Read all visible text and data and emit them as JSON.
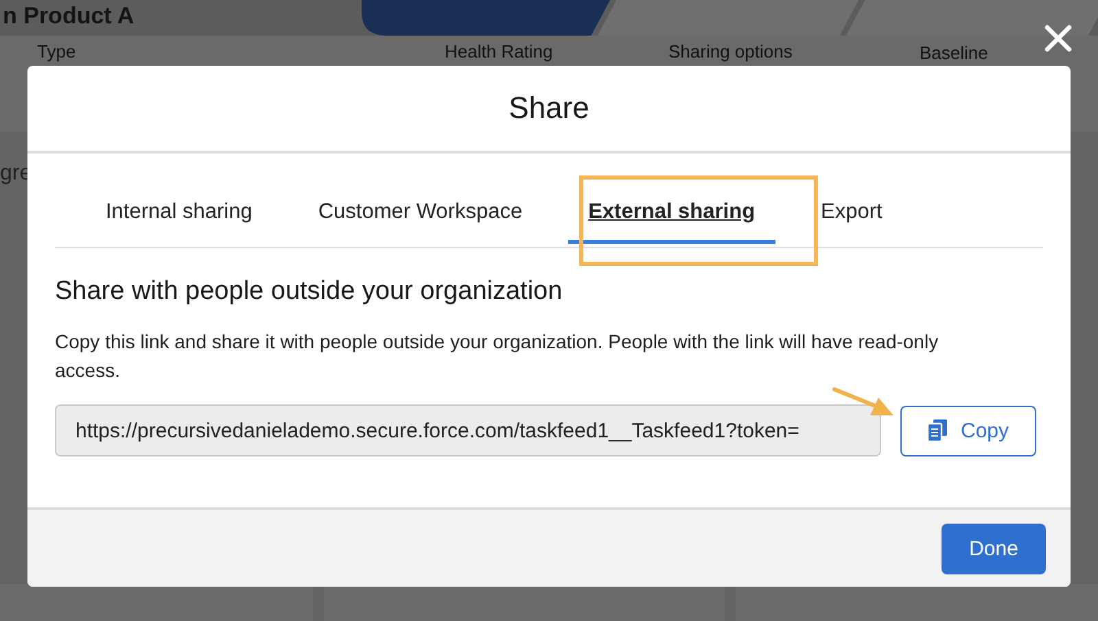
{
  "background": {
    "title": "n Product A",
    "columns": [
      "Type",
      "Health Rating",
      "Sharing options",
      "Baseline"
    ],
    "row_text": "gre"
  },
  "dialog": {
    "title": "Share",
    "tabs": [
      {
        "label": "Internal sharing",
        "selected": false
      },
      {
        "label": "Customer Workspace",
        "selected": false
      },
      {
        "label": "External sharing",
        "selected": true
      },
      {
        "label": "Export",
        "selected": false
      }
    ],
    "heading": "Share with people outside your organization",
    "description": "Copy this link and share it with people outside your organization. People with the link will have read-only access.",
    "link": "https://precursivedanielademo.secure.force.com/taskfeed1__Taskfeed1?token=",
    "copy_button": "Copy",
    "done_button": "Done"
  }
}
